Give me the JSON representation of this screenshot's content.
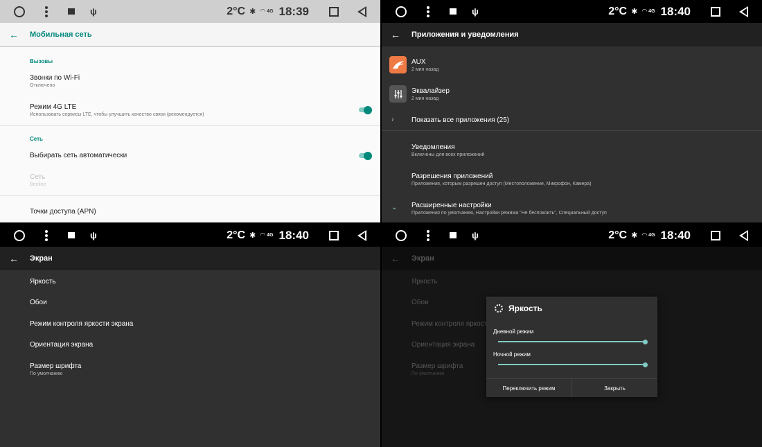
{
  "status": {
    "q1": {
      "temp": "2°C",
      "time": "18:39",
      "sig": "4G"
    },
    "q2": {
      "temp": "2°C",
      "time": "18:40",
      "sig": "4G"
    },
    "q3": {
      "temp": "2°C",
      "time": "18:40",
      "sig": "4G"
    },
    "q4": {
      "temp": "2°C",
      "time": "18:40",
      "sig": "4G"
    }
  },
  "mobile": {
    "title": "Мобильная сеть",
    "sec_calls": "Вызовы",
    "wifi_calls": {
      "title": "Звонки по Wi-Fi",
      "sub": "Отключено"
    },
    "lte": {
      "title": "Режим 4G LTE",
      "sub": "Использовать сервисы LTE, чтобы улучшить качество связи (рекомендуется)"
    },
    "sec_net": "Сеть",
    "auto_net": {
      "title": "Выбирать сеть автоматически"
    },
    "network": {
      "title": "Сеть",
      "sub": "Beeline"
    },
    "apn": {
      "title": "Точки доступа (APN)"
    }
  },
  "apps": {
    "title": "Приложения и уведомления",
    "aux": {
      "title": "AUX",
      "sub": "2 мин назад"
    },
    "eq": {
      "title": "Эквалайзер",
      "sub": "2 мин назад"
    },
    "show_all": "Показать все приложения (25)",
    "notifications": {
      "title": "Уведомления",
      "sub": "Включены для всех приложений"
    },
    "permissions": {
      "title": "Разрешения приложений",
      "sub": "Приложения, которым разрешен доступ (Местоположение, Микрофон, Камера)"
    },
    "advanced": {
      "title": "Расширенные настройки",
      "sub": "Приложения по умолчанию, Настройки режима \"Не беспокоить\", Специальный доступ"
    }
  },
  "screen": {
    "title": "Экран",
    "brightness": "Яркость",
    "wallpaper": "Обои",
    "brightness_mode": "Режим контроля яркости экрана",
    "orientation": "Ориентация экрана",
    "font": {
      "title": "Размер шрифта",
      "sub": "По умолчанию"
    }
  },
  "dialog": {
    "title": "Яркость",
    "day": "Дневной режим",
    "night": "Ночной режим",
    "day_level": 1.0,
    "night_level": 1.0,
    "switch": "Переключить режим",
    "close": "Закрыть"
  },
  "colors": {
    "accent": "#00897b",
    "accent_light": "#80cbc4",
    "aux_icon": "#f07a45"
  }
}
